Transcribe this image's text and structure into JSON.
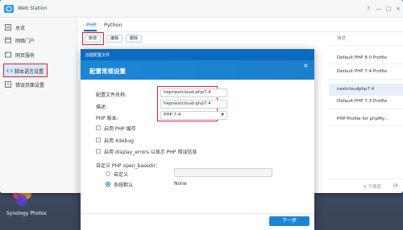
{
  "desktop": {
    "brand": "Synology Photos"
  },
  "window": {
    "title": "Web Station",
    "controls": [
      "?",
      "—",
      "□",
      "×"
    ]
  },
  "sidebar": {
    "items": [
      {
        "label": "总览",
        "icon": "overview-icon"
      },
      {
        "label": "网络门户",
        "icon": "portal-icon"
      },
      {
        "label": "网页服务",
        "icon": "web-service-icon"
      },
      {
        "label": "脚本语言设置",
        "icon": "script-icon"
      },
      {
        "label": "错误页面设置",
        "icon": "error-page-icon"
      }
    ]
  },
  "tabs": [
    "PHP",
    "Python"
  ],
  "toolbar": {
    "add": "新增",
    "edit": "编辑",
    "delete": "删除"
  },
  "table": {
    "header": "描述",
    "rows": [
      "Default PHP 8.0 Profile",
      "Default PHP 7.4 Profile",
      "nextcloudphp7.4",
      "Default PHP 7.3 Profile",
      "PHP Profile for phpMy..."
    ],
    "selected_row": 2,
    "count": "5 个项目"
  },
  "dialog": {
    "window_title": "创建配置文件",
    "heading": "配置常规设置",
    "profile_name_label": "配置文件名称:",
    "profile_name_value": "hepnextcloud-php7.4",
    "description_label": "描述:",
    "description_value": "hepnextcloud-php7.4",
    "php_version_label": "PHP 版本:",
    "php_version_value": "PHP 7.4",
    "options": [
      {
        "label": "启用 PHP 缓存",
        "checked": false
      },
      {
        "label": "启用 Xdebug",
        "checked": false
      },
      {
        "label": "启用 display_errors 以显示 PHP 错误信息",
        "checked": false
      }
    ],
    "open_basedir_label": "自定义 PHP open_basedir：",
    "radio_custom": "自定义",
    "radio_default": "系统默认",
    "default_value": "None",
    "next_button": "下一步"
  },
  "colors": {
    "accent": "#1b86d6",
    "highlight": "#e0202a"
  }
}
